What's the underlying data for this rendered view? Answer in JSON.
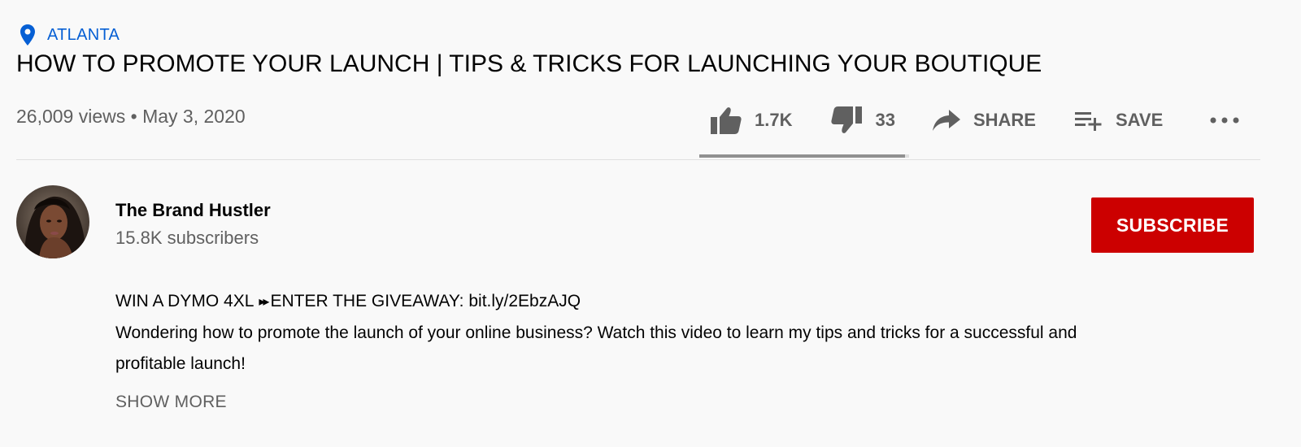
{
  "video": {
    "location": "ATLANTA",
    "title": "HOW TO PROMOTE YOUR LAUNCH | TIPS & TRICKS FOR LAUNCHING YOUR BOUTIQUE",
    "views": "26,009 views",
    "separator": "•",
    "date": "May 3, 2020"
  },
  "actions": {
    "likes": "1.7K",
    "dislikes": "33",
    "share_label": "SHARE",
    "save_label": "SAVE",
    "like_ratio": 0.98
  },
  "channel": {
    "name": "The Brand Hustler",
    "subscribers": "15.8K subscribers",
    "subscribe_label": "SUBSCRIBE"
  },
  "description": {
    "line1_prefix": "WIN A DYMO 4XL",
    "line1_arrows": "▸▸",
    "line1_suffix": "ENTER THE GIVEAWAY: ",
    "link": "bit.ly/2EbzAJQ",
    "body": "Wondering how to promote the launch of your online business? Watch this video to learn my tips and tricks for a successful and profitable launch!",
    "show_more": "SHOW MORE"
  },
  "icons": {
    "location": "location-pin-icon",
    "like": "thumbs-up-icon",
    "dislike": "thumbs-down-icon",
    "share": "share-arrow-icon",
    "save": "playlist-add-icon",
    "more": "more-horizontal-icon"
  },
  "colors": {
    "link_blue": "#065fd4",
    "subscribe_red": "#cc0000",
    "secondary_text": "#606060",
    "background": "#f9f9f9"
  }
}
